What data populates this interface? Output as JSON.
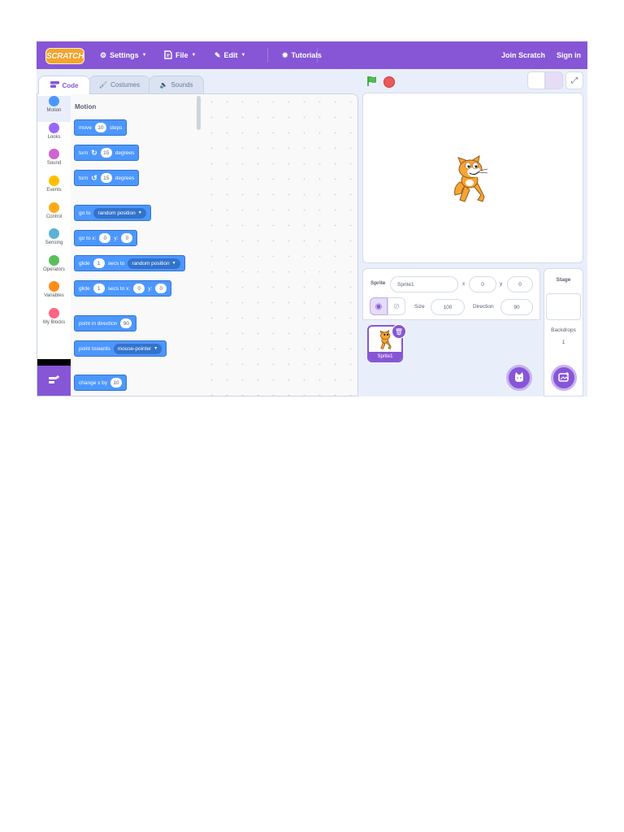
{
  "menubar": {
    "logo": "SCRATCH",
    "settings": "Settings",
    "file": "File",
    "edit": "Edit",
    "tutorials": "Tutorials",
    "join": "Join Scratch",
    "signin": "Sign in"
  },
  "tabs": {
    "code": "Code",
    "costumes": "Costumes",
    "sounds": "Sounds"
  },
  "categories": [
    {
      "label": "Motion",
      "color": "#4c97ff"
    },
    {
      "label": "Looks",
      "color": "#9966ff"
    },
    {
      "label": "Sound",
      "color": "#cf63cf"
    },
    {
      "label": "Events",
      "color": "#ffbf00"
    },
    {
      "label": "Control",
      "color": "#ffab19"
    },
    {
      "label": "Sensing",
      "color": "#5cb1d6"
    },
    {
      "label": "Operators",
      "color": "#59c059"
    },
    {
      "label": "Variables",
      "color": "#ff8c1a"
    },
    {
      "label": "My Blocks",
      "color": "#ff6680"
    }
  ],
  "palette": {
    "title": "Motion",
    "move": {
      "a": "move",
      "v": "10",
      "b": "steps"
    },
    "turn_right": {
      "a": "turn",
      "v": "15",
      "b": "degrees"
    },
    "turn_left": {
      "a": "turn",
      "v": "15",
      "b": "degrees"
    },
    "goto": {
      "a": "go to",
      "drop": "random position"
    },
    "goto_xy": {
      "a": "go to x:",
      "x": "0",
      "b": "y:",
      "y": "0"
    },
    "glide": {
      "a": "glide",
      "v": "1",
      "b": "secs to",
      "drop": "random position"
    },
    "glide_xy": {
      "a": "glide",
      "v": "1",
      "b": "secs to x:",
      "x": "0",
      "c": "y:",
      "y": "0"
    },
    "point_dir": {
      "a": "point in direction",
      "v": "90"
    },
    "point_towards": {
      "a": "point towards",
      "drop": "mouse-pointer"
    },
    "change_x": {
      "a": "change x by",
      "v": "10"
    }
  },
  "sprite": {
    "label": "Sprite",
    "name": "Sprite1",
    "x_label": "x",
    "x": "0",
    "y_label": "y",
    "y": "0",
    "size_label": "Size",
    "size": "100",
    "direction_label": "Direction",
    "direction": "90",
    "card_name": "Sprite1"
  },
  "stage_panel": {
    "title": "Stage",
    "backdrops_label": "Backdrops",
    "backdrops_count": "1"
  }
}
